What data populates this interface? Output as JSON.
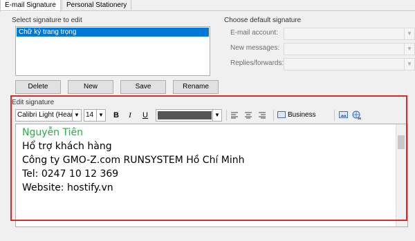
{
  "tabs": [
    {
      "label": "E-mail Signature"
    },
    {
      "label": "Personal Stationery"
    }
  ],
  "select_section": {
    "label": "Select signature to edit",
    "items": [
      "Chữ ký trang trọng"
    ]
  },
  "buttons": {
    "delete": "Delete",
    "new": "New",
    "save": "Save",
    "rename": "Rename"
  },
  "default_section": {
    "label": "Choose default signature",
    "email_account": "E-mail account:",
    "new_messages": "New messages:",
    "replies": "Replies/forwards:"
  },
  "edit_section": {
    "label": "Edit signature",
    "font": "Calibri Light (Headin",
    "size": "14",
    "bold": "B",
    "italic": "I",
    "underline": "U",
    "business_card": "Business Card"
  },
  "signature": {
    "name": "Nguyễn Tiên",
    "lines": [
      "Hổ trợ khách hàng",
      "Công ty GMO-Z.com RUNSYSTEM Hồ Chí Minh",
      "Tel: 0247 10 12 369",
      "Website: hostify.vn"
    ],
    "name_color": "#2eaa4a",
    "text_color": "#000000"
  },
  "highlight_color": "#d42a2a",
  "icons": [
    "align-left-icon",
    "align-center-icon",
    "align-right-icon",
    "business-card-icon",
    "insert-picture-icon",
    "hyperlink-icon"
  ]
}
